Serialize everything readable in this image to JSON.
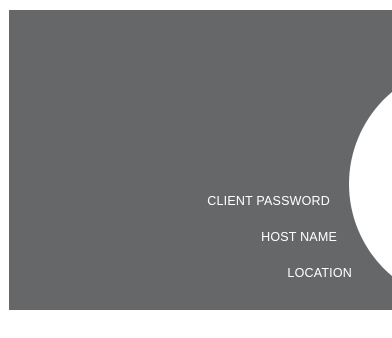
{
  "labels": {
    "client_password": "CLIENT PASSWORD",
    "host_name": "HOST NAME",
    "location": "LOCATION"
  },
  "colors": {
    "panel_background": "#666769",
    "circle": "#ffffff",
    "text": "#ffffff"
  }
}
